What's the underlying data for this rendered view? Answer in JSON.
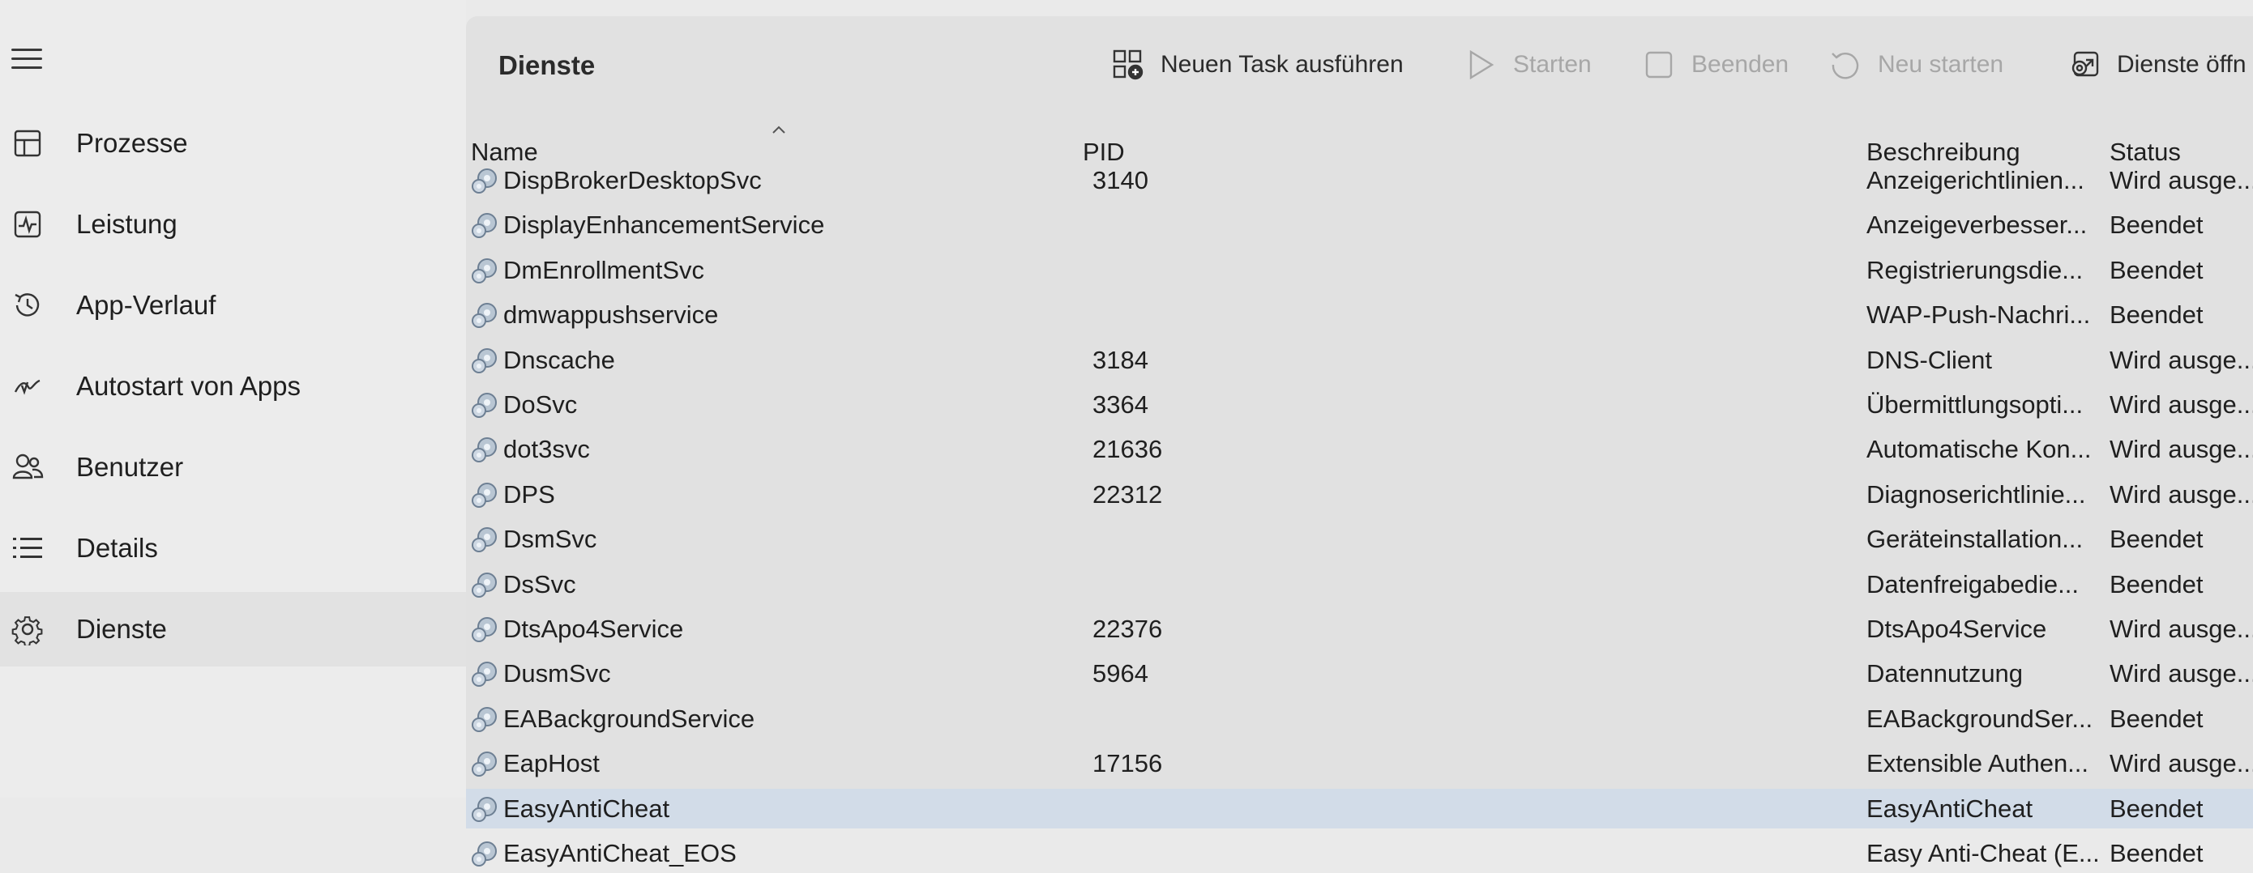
{
  "sidebar": {
    "items": [
      {
        "label": "Prozesse",
        "icon": "processes-icon"
      },
      {
        "label": "Leistung",
        "icon": "performance-icon"
      },
      {
        "label": "App-Verlauf",
        "icon": "history-icon"
      },
      {
        "label": "Autostart von Apps",
        "icon": "startup-icon"
      },
      {
        "label": "Benutzer",
        "icon": "users-icon"
      },
      {
        "label": "Details",
        "icon": "details-icon"
      },
      {
        "label": "Dienste",
        "icon": "services-icon"
      }
    ]
  },
  "toolbar": {
    "title": "Dienste",
    "run_task": "Neuen Task ausführen",
    "start": "Starten",
    "stop": "Beenden",
    "restart": "Neu starten",
    "open_services": "Dienste öffn"
  },
  "table": {
    "columns": {
      "name": "Name",
      "pid": "PID",
      "desc": "Beschreibung",
      "status": "Status"
    },
    "rows": [
      {
        "name": "DispBrokerDesktopSvc",
        "pid": "3140",
        "desc": "Anzeigerichtlinien...",
        "status": "Wird ausge..."
      },
      {
        "name": "DisplayEnhancementService",
        "pid": "",
        "desc": "Anzeigeverbesser...",
        "status": "Beendet"
      },
      {
        "name": "DmEnrollmentSvc",
        "pid": "",
        "desc": "Registrierungsdie...",
        "status": "Beendet"
      },
      {
        "name": "dmwappushservice",
        "pid": "",
        "desc": "WAP-Push-Nachri...",
        "status": "Beendet"
      },
      {
        "name": "Dnscache",
        "pid": "3184",
        "desc": "DNS-Client",
        "status": "Wird ausge..."
      },
      {
        "name": "DoSvc",
        "pid": "3364",
        "desc": "Übermittlungsopti...",
        "status": "Wird ausge..."
      },
      {
        "name": "dot3svc",
        "pid": "21636",
        "desc": "Automatische Kon...",
        "status": "Wird ausge..."
      },
      {
        "name": "DPS",
        "pid": "22312",
        "desc": "Diagnoserichtlinie...",
        "status": "Wird ausge..."
      },
      {
        "name": "DsmSvc",
        "pid": "",
        "desc": "Geräteinstallation...",
        "status": "Beendet"
      },
      {
        "name": "DsSvc",
        "pid": "",
        "desc": "Datenfreigabedie...",
        "status": "Beendet"
      },
      {
        "name": "DtsApo4Service",
        "pid": "22376",
        "desc": "DtsApo4Service",
        "status": "Wird ausge..."
      },
      {
        "name": "DusmSvc",
        "pid": "5964",
        "desc": "Datennutzung",
        "status": "Wird ausge..."
      },
      {
        "name": "EABackgroundService",
        "pid": "",
        "desc": "EABackgroundSer...",
        "status": "Beendet"
      },
      {
        "name": "EapHost",
        "pid": "17156",
        "desc": "Extensible Authen...",
        "status": "Wird ausge..."
      },
      {
        "name": "EasyAntiCheat",
        "pid": "",
        "desc": "EasyAntiCheat",
        "status": "Beendet",
        "selected": true
      },
      {
        "name": "EasyAntiCheat_EOS",
        "pid": "",
        "desc": "Easy Anti-Cheat (E...",
        "status": "Beendet"
      }
    ]
  }
}
